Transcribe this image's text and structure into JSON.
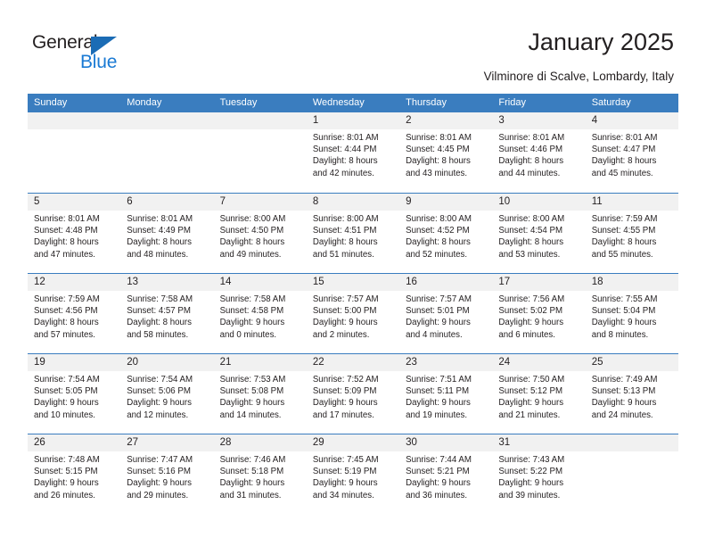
{
  "brand": {
    "name_part1": "General",
    "name_part2": "Blue",
    "accent_color": "#1a7ad4",
    "triangle_color": "#1b6cb5"
  },
  "header": {
    "title": "January 2025",
    "subtitle": "Vilminore di Scalve, Lombardy, Italy"
  },
  "calendar": {
    "header_bg": "#3a7dbf",
    "weekdays": [
      "Sunday",
      "Monday",
      "Tuesday",
      "Wednesday",
      "Thursday",
      "Friday",
      "Saturday"
    ],
    "weeks": [
      [
        {
          "empty": true
        },
        {
          "empty": true
        },
        {
          "empty": true
        },
        {
          "day": "1",
          "sunrise": "Sunrise: 8:01 AM",
          "sunset": "Sunset: 4:44 PM",
          "daylight1": "Daylight: 8 hours",
          "daylight2": "and 42 minutes."
        },
        {
          "day": "2",
          "sunrise": "Sunrise: 8:01 AM",
          "sunset": "Sunset: 4:45 PM",
          "daylight1": "Daylight: 8 hours",
          "daylight2": "and 43 minutes."
        },
        {
          "day": "3",
          "sunrise": "Sunrise: 8:01 AM",
          "sunset": "Sunset: 4:46 PM",
          "daylight1": "Daylight: 8 hours",
          "daylight2": "and 44 minutes."
        },
        {
          "day": "4",
          "sunrise": "Sunrise: 8:01 AM",
          "sunset": "Sunset: 4:47 PM",
          "daylight1": "Daylight: 8 hours",
          "daylight2": "and 45 minutes."
        }
      ],
      [
        {
          "day": "5",
          "sunrise": "Sunrise: 8:01 AM",
          "sunset": "Sunset: 4:48 PM",
          "daylight1": "Daylight: 8 hours",
          "daylight2": "and 47 minutes."
        },
        {
          "day": "6",
          "sunrise": "Sunrise: 8:01 AM",
          "sunset": "Sunset: 4:49 PM",
          "daylight1": "Daylight: 8 hours",
          "daylight2": "and 48 minutes."
        },
        {
          "day": "7",
          "sunrise": "Sunrise: 8:00 AM",
          "sunset": "Sunset: 4:50 PM",
          "daylight1": "Daylight: 8 hours",
          "daylight2": "and 49 minutes."
        },
        {
          "day": "8",
          "sunrise": "Sunrise: 8:00 AM",
          "sunset": "Sunset: 4:51 PM",
          "daylight1": "Daylight: 8 hours",
          "daylight2": "and 51 minutes."
        },
        {
          "day": "9",
          "sunrise": "Sunrise: 8:00 AM",
          "sunset": "Sunset: 4:52 PM",
          "daylight1": "Daylight: 8 hours",
          "daylight2": "and 52 minutes."
        },
        {
          "day": "10",
          "sunrise": "Sunrise: 8:00 AM",
          "sunset": "Sunset: 4:54 PM",
          "daylight1": "Daylight: 8 hours",
          "daylight2": "and 53 minutes."
        },
        {
          "day": "11",
          "sunrise": "Sunrise: 7:59 AM",
          "sunset": "Sunset: 4:55 PM",
          "daylight1": "Daylight: 8 hours",
          "daylight2": "and 55 minutes."
        }
      ],
      [
        {
          "day": "12",
          "sunrise": "Sunrise: 7:59 AM",
          "sunset": "Sunset: 4:56 PM",
          "daylight1": "Daylight: 8 hours",
          "daylight2": "and 57 minutes."
        },
        {
          "day": "13",
          "sunrise": "Sunrise: 7:58 AM",
          "sunset": "Sunset: 4:57 PM",
          "daylight1": "Daylight: 8 hours",
          "daylight2": "and 58 minutes."
        },
        {
          "day": "14",
          "sunrise": "Sunrise: 7:58 AM",
          "sunset": "Sunset: 4:58 PM",
          "daylight1": "Daylight: 9 hours",
          "daylight2": "and 0 minutes."
        },
        {
          "day": "15",
          "sunrise": "Sunrise: 7:57 AM",
          "sunset": "Sunset: 5:00 PM",
          "daylight1": "Daylight: 9 hours",
          "daylight2": "and 2 minutes."
        },
        {
          "day": "16",
          "sunrise": "Sunrise: 7:57 AM",
          "sunset": "Sunset: 5:01 PM",
          "daylight1": "Daylight: 9 hours",
          "daylight2": "and 4 minutes."
        },
        {
          "day": "17",
          "sunrise": "Sunrise: 7:56 AM",
          "sunset": "Sunset: 5:02 PM",
          "daylight1": "Daylight: 9 hours",
          "daylight2": "and 6 minutes."
        },
        {
          "day": "18",
          "sunrise": "Sunrise: 7:55 AM",
          "sunset": "Sunset: 5:04 PM",
          "daylight1": "Daylight: 9 hours",
          "daylight2": "and 8 minutes."
        }
      ],
      [
        {
          "day": "19",
          "sunrise": "Sunrise: 7:54 AM",
          "sunset": "Sunset: 5:05 PM",
          "daylight1": "Daylight: 9 hours",
          "daylight2": "and 10 minutes."
        },
        {
          "day": "20",
          "sunrise": "Sunrise: 7:54 AM",
          "sunset": "Sunset: 5:06 PM",
          "daylight1": "Daylight: 9 hours",
          "daylight2": "and 12 minutes."
        },
        {
          "day": "21",
          "sunrise": "Sunrise: 7:53 AM",
          "sunset": "Sunset: 5:08 PM",
          "daylight1": "Daylight: 9 hours",
          "daylight2": "and 14 minutes."
        },
        {
          "day": "22",
          "sunrise": "Sunrise: 7:52 AM",
          "sunset": "Sunset: 5:09 PM",
          "daylight1": "Daylight: 9 hours",
          "daylight2": "and 17 minutes."
        },
        {
          "day": "23",
          "sunrise": "Sunrise: 7:51 AM",
          "sunset": "Sunset: 5:11 PM",
          "daylight1": "Daylight: 9 hours",
          "daylight2": "and 19 minutes."
        },
        {
          "day": "24",
          "sunrise": "Sunrise: 7:50 AM",
          "sunset": "Sunset: 5:12 PM",
          "daylight1": "Daylight: 9 hours",
          "daylight2": "and 21 minutes."
        },
        {
          "day": "25",
          "sunrise": "Sunrise: 7:49 AM",
          "sunset": "Sunset: 5:13 PM",
          "daylight1": "Daylight: 9 hours",
          "daylight2": "and 24 minutes."
        }
      ],
      [
        {
          "day": "26",
          "sunrise": "Sunrise: 7:48 AM",
          "sunset": "Sunset: 5:15 PM",
          "daylight1": "Daylight: 9 hours",
          "daylight2": "and 26 minutes."
        },
        {
          "day": "27",
          "sunrise": "Sunrise: 7:47 AM",
          "sunset": "Sunset: 5:16 PM",
          "daylight1": "Daylight: 9 hours",
          "daylight2": "and 29 minutes."
        },
        {
          "day": "28",
          "sunrise": "Sunrise: 7:46 AM",
          "sunset": "Sunset: 5:18 PM",
          "daylight1": "Daylight: 9 hours",
          "daylight2": "and 31 minutes."
        },
        {
          "day": "29",
          "sunrise": "Sunrise: 7:45 AM",
          "sunset": "Sunset: 5:19 PM",
          "daylight1": "Daylight: 9 hours",
          "daylight2": "and 34 minutes."
        },
        {
          "day": "30",
          "sunrise": "Sunrise: 7:44 AM",
          "sunset": "Sunset: 5:21 PM",
          "daylight1": "Daylight: 9 hours",
          "daylight2": "and 36 minutes."
        },
        {
          "day": "31",
          "sunrise": "Sunrise: 7:43 AM",
          "sunset": "Sunset: 5:22 PM",
          "daylight1": "Daylight: 9 hours",
          "daylight2": "and 39 minutes."
        },
        {
          "empty": true
        }
      ]
    ]
  }
}
